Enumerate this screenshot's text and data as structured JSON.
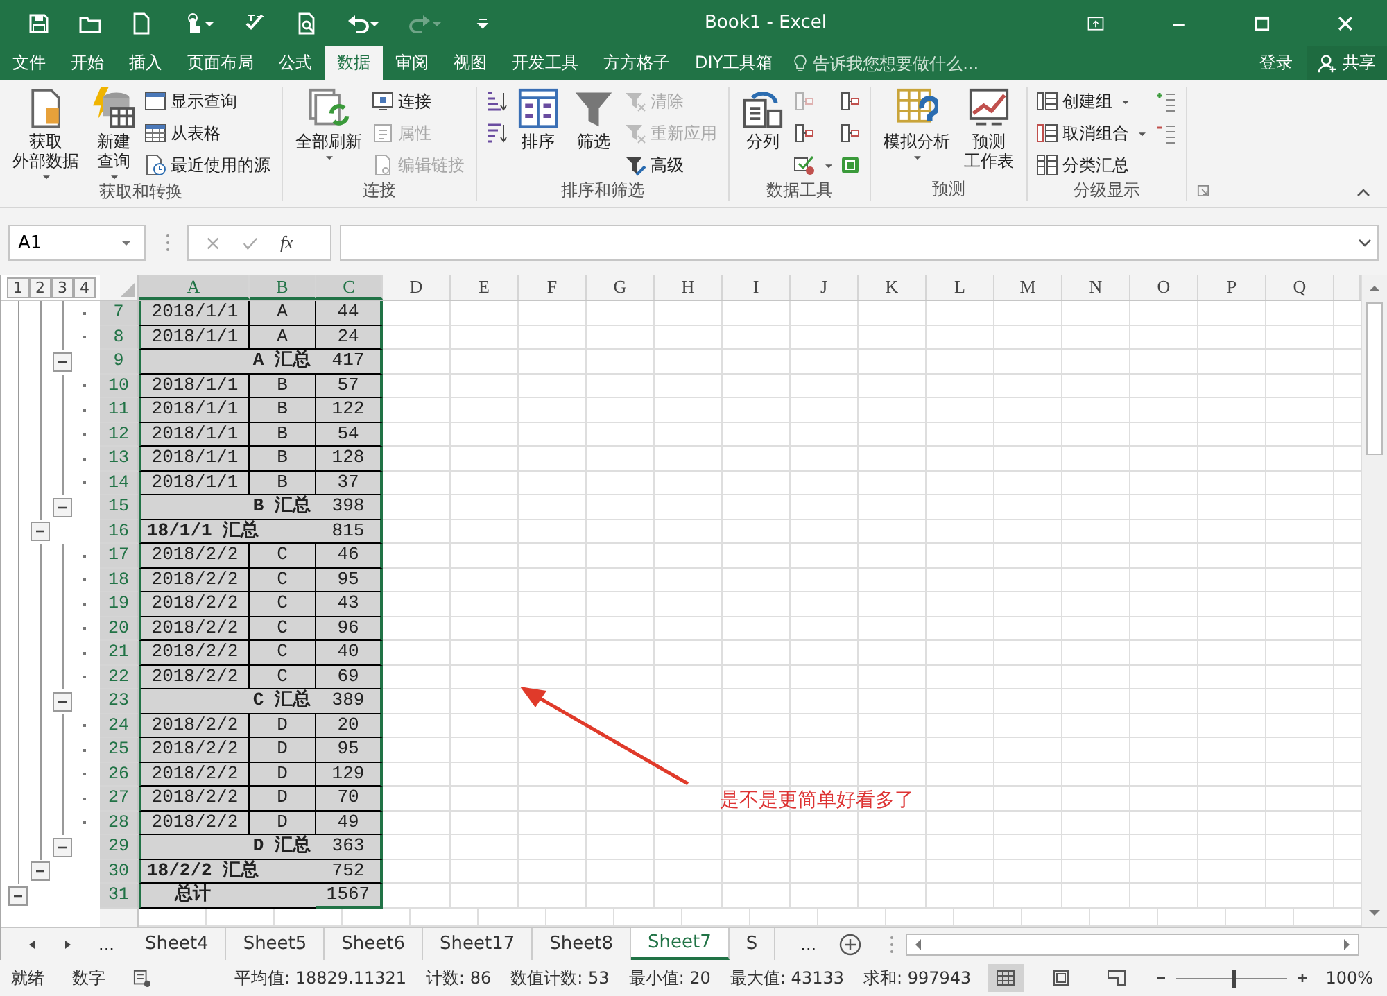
{
  "window": {
    "title": "Book1 - Excel"
  },
  "quick_access": {
    "redo_disabled": true
  },
  "menu_tabs": [
    {
      "label": "文件",
      "selected": false
    },
    {
      "label": "开始",
      "selected": false
    },
    {
      "label": "插入",
      "selected": false
    },
    {
      "label": "页面布局",
      "selected": false
    },
    {
      "label": "公式",
      "selected": false
    },
    {
      "label": "数据",
      "selected": true
    },
    {
      "label": "审阅",
      "selected": false
    },
    {
      "label": "视图",
      "selected": false
    },
    {
      "label": "开发工具",
      "selected": false
    },
    {
      "label": "方方格子",
      "selected": false
    },
    {
      "label": "DIY工具箱",
      "selected": false
    }
  ],
  "tell_me": {
    "placeholder": "告诉我您想要做什么..."
  },
  "sign_in": "登录",
  "share": "共享",
  "ribbon": {
    "groups": [
      {
        "label": "获取和转换",
        "items": [
          {
            "kind": "large",
            "lines": [
              "获取",
              "外部数据"
            ],
            "menu": true,
            "disabled": false
          },
          {
            "kind": "large",
            "lines": [
              "新建",
              "查询"
            ],
            "menu": true,
            "disabled": false
          },
          {
            "kind": "stack",
            "items": [
              {
                "label": "显示查询",
                "menu": false,
                "disabled": false
              },
              {
                "label": "从表格",
                "menu": false,
                "disabled": false
              },
              {
                "label": "最近使用的源",
                "menu": false,
                "disabled": false
              }
            ]
          }
        ]
      },
      {
        "label": "连接",
        "items": [
          {
            "kind": "large",
            "lines": [
              "全部刷新"
            ],
            "menu": true,
            "disabled": false
          },
          {
            "kind": "stack",
            "items": [
              {
                "label": "连接",
                "menu": false,
                "disabled": false
              },
              {
                "label": "属性",
                "menu": false,
                "disabled": true
              },
              {
                "label": "编辑链接",
                "menu": false,
                "disabled": true
              }
            ]
          }
        ]
      },
      {
        "label": "排序和筛选",
        "items": [
          {
            "kind": "icon_stack",
            "items": [
              {
                "menu": false,
                "disabled": false
              },
              {
                "menu": false,
                "disabled": false
              }
            ]
          },
          {
            "kind": "large",
            "lines": [
              "排序"
            ],
            "menu": false,
            "disabled": false
          },
          {
            "kind": "large",
            "lines": [
              "筛选"
            ],
            "menu": false,
            "disabled": false
          },
          {
            "kind": "stack",
            "items": [
              {
                "label": "清除",
                "menu": false,
                "disabled": true
              },
              {
                "label": "重新应用",
                "menu": false,
                "disabled": true
              },
              {
                "label": "高级",
                "menu": false,
                "disabled": false
              }
            ]
          }
        ]
      },
      {
        "label": "数据工具",
        "items": [
          {
            "kind": "large",
            "lines": [
              "分列"
            ],
            "menu": false,
            "disabled": false
          },
          {
            "kind": "icon_stack",
            "items": [
              {
                "menu": false,
                "disabled": true
              },
              {
                "menu": false,
                "disabled": false
              },
              {
                "menu": true,
                "disabled": false
              }
            ]
          },
          {
            "kind": "icon_stack",
            "items": [
              {
                "menu": false,
                "disabled": false
              },
              {
                "menu": false,
                "disabled": false
              },
              {
                "menu": false,
                "disabled": false
              }
            ]
          }
        ]
      },
      {
        "label": "预测",
        "items": [
          {
            "kind": "large",
            "lines": [
              "模拟分析"
            ],
            "menu": true,
            "disabled": false
          },
          {
            "kind": "large",
            "lines": [
              "预测",
              "工作表"
            ],
            "menu": false,
            "disabled": false
          }
        ]
      },
      {
        "label": "分级显示",
        "items": [
          {
            "kind": "stack",
            "items": [
              {
                "label": "创建组",
                "menu": true,
                "disabled": false
              },
              {
                "label": "取消组合",
                "menu": true,
                "disabled": false
              },
              {
                "label": "分类汇总",
                "menu": false,
                "disabled": false
              }
            ]
          },
          {
            "kind": "icon_stack",
            "items": [
              {
                "menu": false,
                "disabled": false
              },
              {
                "menu": false,
                "disabled": false
              }
            ]
          }
        ]
      }
    ]
  },
  "formula_bar": {
    "name_box": "A1",
    "function_label": "fx"
  },
  "outline_levels": [
    "1",
    "2",
    "3",
    "4"
  ],
  "columns": [
    {
      "label": "A",
      "selected": true
    },
    {
      "label": "B",
      "selected": true
    },
    {
      "label": "C",
      "selected": true
    },
    {
      "label": "D",
      "selected": false
    },
    {
      "label": "E",
      "selected": false
    },
    {
      "label": "F",
      "selected": false
    },
    {
      "label": "G",
      "selected": false
    },
    {
      "label": "H",
      "selected": false
    },
    {
      "label": "I",
      "selected": false
    },
    {
      "label": "J",
      "selected": false
    },
    {
      "label": "K",
      "selected": false
    },
    {
      "label": "L",
      "selected": false
    },
    {
      "label": "M",
      "selected": false
    },
    {
      "label": "N",
      "selected": false
    },
    {
      "label": "O",
      "selected": false
    },
    {
      "label": "P",
      "selected": false
    },
    {
      "label": "Q",
      "selected": false
    }
  ],
  "rows": [
    {
      "number": "7",
      "kind": "detail",
      "selected": true,
      "a": "2018/1/1",
      "b": "A",
      "c": "44"
    },
    {
      "number": "8",
      "kind": "detail",
      "selected": true,
      "a": "2018/1/1",
      "b": "A",
      "c": "24"
    },
    {
      "number": "9",
      "kind": "subtotal",
      "selected": true,
      "label": "A 汇总",
      "c": "417"
    },
    {
      "number": "10",
      "kind": "detail",
      "selected": true,
      "a": "2018/1/1",
      "b": "B",
      "c": "57"
    },
    {
      "number": "11",
      "kind": "detail",
      "selected": true,
      "a": "2018/1/1",
      "b": "B",
      "c": "122"
    },
    {
      "number": "12",
      "kind": "detail",
      "selected": true,
      "a": "2018/1/1",
      "b": "B",
      "c": "54"
    },
    {
      "number": "13",
      "kind": "detail",
      "selected": true,
      "a": "2018/1/1",
      "b": "B",
      "c": "128"
    },
    {
      "number": "14",
      "kind": "detail",
      "selected": true,
      "a": "2018/1/1",
      "b": "B",
      "c": "37"
    },
    {
      "number": "15",
      "kind": "subtotal",
      "selected": true,
      "label": "B 汇总",
      "c": "398"
    },
    {
      "number": "16",
      "kind": "group_total",
      "selected": true,
      "label": "18/1/1 汇总",
      "c": "815"
    },
    {
      "number": "17",
      "kind": "detail",
      "selected": true,
      "a": "2018/2/2",
      "b": "C",
      "c": "46"
    },
    {
      "number": "18",
      "kind": "detail",
      "selected": true,
      "a": "2018/2/2",
      "b": "C",
      "c": "95"
    },
    {
      "number": "19",
      "kind": "detail",
      "selected": true,
      "a": "2018/2/2",
      "b": "C",
      "c": "43"
    },
    {
      "number": "20",
      "kind": "detail",
      "selected": true,
      "a": "2018/2/2",
      "b": "C",
      "c": "96"
    },
    {
      "number": "21",
      "kind": "detail",
      "selected": true,
      "a": "2018/2/2",
      "b": "C",
      "c": "40"
    },
    {
      "number": "22",
      "kind": "detail",
      "selected": true,
      "a": "2018/2/2",
      "b": "C",
      "c": "69"
    },
    {
      "number": "23",
      "kind": "subtotal",
      "selected": true,
      "label": "C 汇总",
      "c": "389"
    },
    {
      "number": "24",
      "kind": "detail",
      "selected": true,
      "a": "2018/2/2",
      "b": "D",
      "c": "20"
    },
    {
      "number": "25",
      "kind": "detail",
      "selected": true,
      "a": "2018/2/2",
      "b": "D",
      "c": "95"
    },
    {
      "number": "26",
      "kind": "detail",
      "selected": true,
      "a": "2018/2/2",
      "b": "D",
      "c": "129"
    },
    {
      "number": "27",
      "kind": "detail",
      "selected": true,
      "a": "2018/2/2",
      "b": "D",
      "c": "70"
    },
    {
      "number": "28",
      "kind": "detail",
      "selected": true,
      "a": "2018/2/2",
      "b": "D",
      "c": "49"
    },
    {
      "number": "29",
      "kind": "subtotal",
      "selected": true,
      "label": "D 汇总",
      "c": "363"
    },
    {
      "number": "30",
      "kind": "group_total",
      "selected": true,
      "label": "18/2/2 汇总",
      "c": "752"
    },
    {
      "number": "31",
      "kind": "grand_total",
      "selected": true,
      "label": "总计",
      "c": "1567"
    }
  ],
  "annotation": {
    "text": "是不是更简单好看多了"
  },
  "sheet_bar": {
    "overflow_left": "...",
    "overflow_right": "...",
    "tabs": [
      {
        "label": "Sheet4",
        "selected": false
      },
      {
        "label": "Sheet5",
        "selected": false
      },
      {
        "label": "Sheet6",
        "selected": false
      },
      {
        "label": "Sheet17",
        "selected": false
      },
      {
        "label": "Sheet8",
        "selected": false
      },
      {
        "label": "Sheet7",
        "selected": true
      },
      {
        "label": "S",
        "selected": false
      }
    ]
  },
  "status_bar": {
    "ready": "就绪",
    "mode": "数字",
    "stats": [
      "平均值: 18829.11321",
      "计数: 86",
      "数值计数: 53",
      "最小值: 20",
      "最大值: 43133",
      "求和: 997943"
    ],
    "views": [
      {
        "kind": "normal",
        "selected": true
      },
      {
        "kind": "page_layout",
        "selected": false
      },
      {
        "kind": "page_break",
        "selected": false
      }
    ],
    "zoom": {
      "level": 0.5,
      "reading": "100%"
    }
  }
}
